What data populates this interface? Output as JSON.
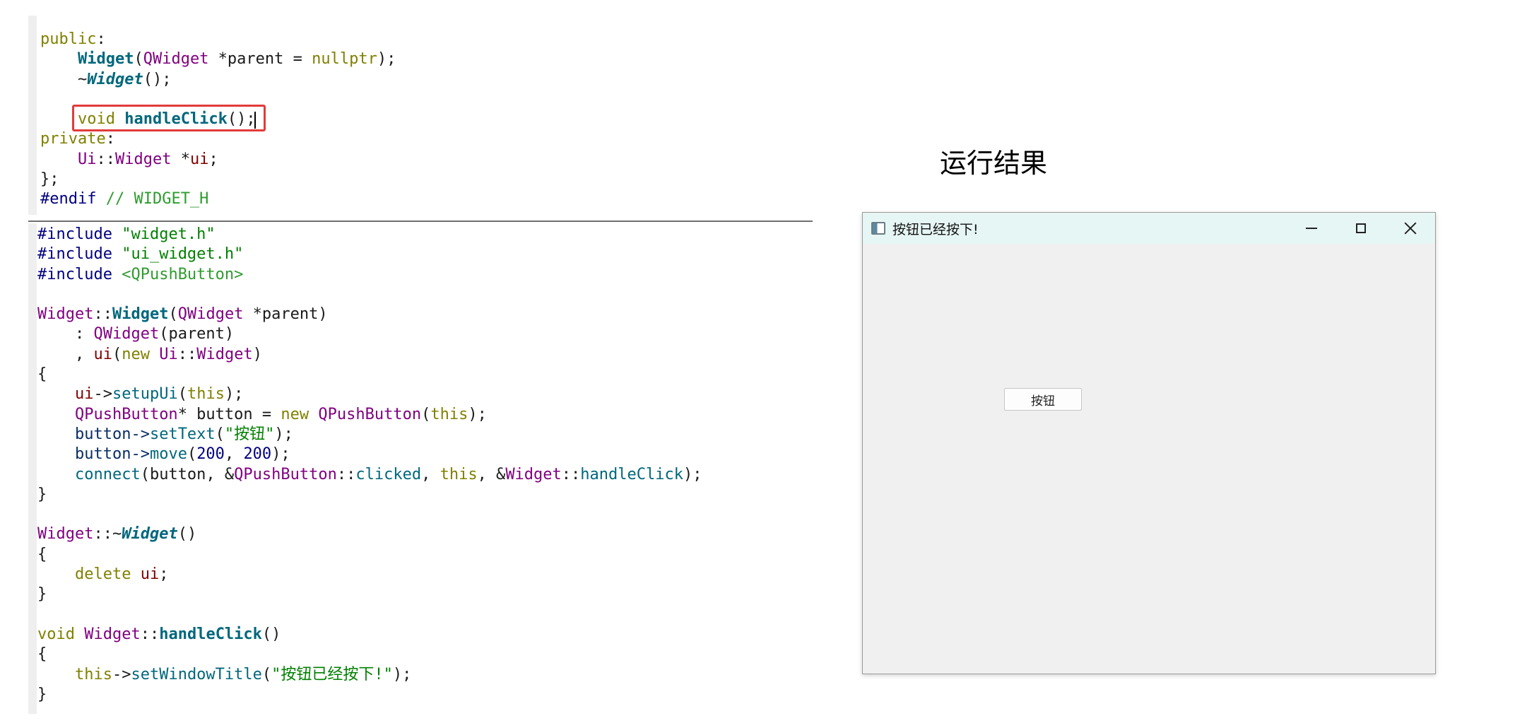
{
  "header_code": {
    "lines": [
      {
        "tokens": [
          {
            "t": "public",
            "c": "kw-olive"
          },
          {
            "t": ":",
            "c": "plain"
          }
        ]
      },
      {
        "tokens": [
          {
            "t": "    ",
            "c": "plain"
          },
          {
            "t": "Widget",
            "c": "fn-bold"
          },
          {
            "t": "(",
            "c": "plain"
          },
          {
            "t": "QWidget",
            "c": "cls"
          },
          {
            "t": " *parent = ",
            "c": "plain"
          },
          {
            "t": "nullptr",
            "c": "kw-olive"
          },
          {
            "t": ");",
            "c": "plain"
          }
        ]
      },
      {
        "tokens": [
          {
            "t": "    ~",
            "c": "plain"
          },
          {
            "t": "Widget",
            "c": "fn-bold italic"
          },
          {
            "t": "();",
            "c": "plain"
          }
        ]
      },
      {
        "tokens": [
          {
            "t": "",
            "c": "plain"
          }
        ]
      },
      {
        "tokens": [
          {
            "t": "    ",
            "c": "plain"
          },
          {
            "t": "void",
            "c": "kw-olive"
          },
          {
            "t": " ",
            "c": "plain"
          },
          {
            "t": "handleClick",
            "c": "fn-bold"
          },
          {
            "t": "();",
            "c": "plain"
          }
        ]
      },
      {
        "tokens": [
          {
            "t": "private",
            "c": "kw-olive"
          },
          {
            "t": ":",
            "c": "plain"
          }
        ]
      },
      {
        "tokens": [
          {
            "t": "    ",
            "c": "plain"
          },
          {
            "t": "Ui",
            "c": "cls"
          },
          {
            "t": "::",
            "c": "plain"
          },
          {
            "t": "Widget",
            "c": "cls"
          },
          {
            "t": " *",
            "c": "plain"
          },
          {
            "t": "ui",
            "c": "member"
          },
          {
            "t": ";",
            "c": "plain"
          }
        ]
      },
      {
        "tokens": [
          {
            "t": "};",
            "c": "plain"
          }
        ]
      },
      {
        "tokens": [
          {
            "t": "#endif",
            "c": "kw-navy"
          },
          {
            "t": " // WIDGET_H",
            "c": "kw-green"
          }
        ]
      }
    ]
  },
  "source_code": {
    "lines": [
      {
        "tokens": [
          {
            "t": "#include",
            "c": "kw-navy"
          },
          {
            "t": " ",
            "c": "plain"
          },
          {
            "t": "\"widget.h\"",
            "c": "str"
          }
        ]
      },
      {
        "tokens": [
          {
            "t": "#include",
            "c": "kw-navy"
          },
          {
            "t": " ",
            "c": "plain"
          },
          {
            "t": "\"ui_widget.h\"",
            "c": "str"
          }
        ]
      },
      {
        "tokens": [
          {
            "t": "#include",
            "c": "kw-navy"
          },
          {
            "t": " ",
            "c": "plain"
          },
          {
            "t": "<QPushButton>",
            "c": "kw-green"
          }
        ]
      },
      {
        "tokens": [
          {
            "t": "",
            "c": "plain"
          }
        ]
      },
      {
        "tokens": [
          {
            "t": "Widget",
            "c": "cls"
          },
          {
            "t": "::",
            "c": "plain"
          },
          {
            "t": "Widget",
            "c": "fn-bold"
          },
          {
            "t": "(",
            "c": "plain"
          },
          {
            "t": "QWidget",
            "c": "cls"
          },
          {
            "t": " *parent)",
            "c": "plain"
          }
        ]
      },
      {
        "tokens": [
          {
            "t": "    : ",
            "c": "plain"
          },
          {
            "t": "QWidget",
            "c": "cls"
          },
          {
            "t": "(parent)",
            "c": "plain"
          }
        ]
      },
      {
        "tokens": [
          {
            "t": "    , ",
            "c": "plain"
          },
          {
            "t": "ui",
            "c": "member"
          },
          {
            "t": "(",
            "c": "plain"
          },
          {
            "t": "new",
            "c": "kw-olive"
          },
          {
            "t": " ",
            "c": "plain"
          },
          {
            "t": "Ui",
            "c": "cls"
          },
          {
            "t": "::",
            "c": "plain"
          },
          {
            "t": "Widget",
            "c": "cls"
          },
          {
            "t": ")",
            "c": "plain"
          }
        ]
      },
      {
        "tokens": [
          {
            "t": "{",
            "c": "plain"
          }
        ]
      },
      {
        "tokens": [
          {
            "t": "    ",
            "c": "plain"
          },
          {
            "t": "ui",
            "c": "member"
          },
          {
            "t": "->",
            "c": "plain"
          },
          {
            "t": "setupUi",
            "c": "fn"
          },
          {
            "t": "(",
            "c": "plain"
          },
          {
            "t": "this",
            "c": "kw-olive"
          },
          {
            "t": ");",
            "c": "plain"
          }
        ]
      },
      {
        "tokens": [
          {
            "t": "    ",
            "c": "plain"
          },
          {
            "t": "QPushButton",
            "c": "cls"
          },
          {
            "t": "* button = ",
            "c": "plain"
          },
          {
            "t": "new",
            "c": "kw-olive"
          },
          {
            "t": " ",
            "c": "plain"
          },
          {
            "t": "QPushButton",
            "c": "cls"
          },
          {
            "t": "(",
            "c": "plain"
          },
          {
            "t": "this",
            "c": "kw-olive"
          },
          {
            "t": ");",
            "c": "plain"
          }
        ]
      },
      {
        "tokens": [
          {
            "t": "    button->",
            "c": "navy-text"
          },
          {
            "t": "setText",
            "c": "fn"
          },
          {
            "t": "(",
            "c": "plain"
          },
          {
            "t": "\"按钮\"",
            "c": "str"
          },
          {
            "t": ");",
            "c": "plain"
          }
        ]
      },
      {
        "tokens": [
          {
            "t": "    button->",
            "c": "navy-text"
          },
          {
            "t": "move",
            "c": "fn"
          },
          {
            "t": "(",
            "c": "plain"
          },
          {
            "t": "200",
            "c": "num"
          },
          {
            "t": ", ",
            "c": "plain"
          },
          {
            "t": "200",
            "c": "num"
          },
          {
            "t": ");",
            "c": "plain"
          }
        ]
      },
      {
        "tokens": [
          {
            "t": "    ",
            "c": "plain"
          },
          {
            "t": "connect",
            "c": "fn"
          },
          {
            "t": "(button, &",
            "c": "plain"
          },
          {
            "t": "QPushButton",
            "c": "cls"
          },
          {
            "t": "::",
            "c": "plain"
          },
          {
            "t": "clicked",
            "c": "fn"
          },
          {
            "t": ", ",
            "c": "plain"
          },
          {
            "t": "this",
            "c": "kw-olive"
          },
          {
            "t": ", &",
            "c": "plain"
          },
          {
            "t": "Widget",
            "c": "cls"
          },
          {
            "t": "::",
            "c": "plain"
          },
          {
            "t": "handleClick",
            "c": "fn"
          },
          {
            "t": ");",
            "c": "plain"
          }
        ]
      },
      {
        "tokens": [
          {
            "t": "}",
            "c": "plain"
          }
        ]
      },
      {
        "tokens": [
          {
            "t": "",
            "c": "plain"
          }
        ]
      },
      {
        "tokens": [
          {
            "t": "Widget",
            "c": "cls"
          },
          {
            "t": "::~",
            "c": "plain"
          },
          {
            "t": "Widget",
            "c": "fn-bold italic"
          },
          {
            "t": "()",
            "c": "plain"
          }
        ]
      },
      {
        "tokens": [
          {
            "t": "{",
            "c": "plain"
          }
        ]
      },
      {
        "tokens": [
          {
            "t": "    ",
            "c": "plain"
          },
          {
            "t": "delete",
            "c": "kw-olive"
          },
          {
            "t": " ",
            "c": "plain"
          },
          {
            "t": "ui",
            "c": "member"
          },
          {
            "t": ";",
            "c": "plain"
          }
        ]
      },
      {
        "tokens": [
          {
            "t": "}",
            "c": "plain"
          }
        ]
      },
      {
        "tokens": [
          {
            "t": "",
            "c": "plain"
          }
        ]
      },
      {
        "tokens": [
          {
            "t": "void",
            "c": "kw-olive"
          },
          {
            "t": " ",
            "c": "plain"
          },
          {
            "t": "Widget",
            "c": "cls"
          },
          {
            "t": "::",
            "c": "plain"
          },
          {
            "t": "handleClick",
            "c": "fn-bold"
          },
          {
            "t": "()",
            "c": "plain"
          }
        ]
      },
      {
        "tokens": [
          {
            "t": "{",
            "c": "plain"
          }
        ]
      },
      {
        "tokens": [
          {
            "t": "    ",
            "c": "plain"
          },
          {
            "t": "this",
            "c": "kw-olive"
          },
          {
            "t": "->",
            "c": "plain"
          },
          {
            "t": "setWindowTitle",
            "c": "fn"
          },
          {
            "t": "(",
            "c": "plain"
          },
          {
            "t": "\"按钮已经按下!\"",
            "c": "str"
          },
          {
            "t": ");",
            "c": "plain"
          }
        ]
      },
      {
        "tokens": [
          {
            "t": "}",
            "c": "plain"
          }
        ]
      }
    ]
  },
  "result_label": "运行结果",
  "app_window": {
    "title": "按钮已经按下!",
    "button_label": "按钮",
    "icons": {
      "app": "app-window-icon",
      "minimize": "minimize-icon",
      "maximize": "maximize-icon",
      "close": "close-icon"
    }
  },
  "colors": {
    "highlight_border": "#e23b3b",
    "titlebar_bg": "#e6f6f4",
    "client_bg": "#f0f0f0"
  }
}
